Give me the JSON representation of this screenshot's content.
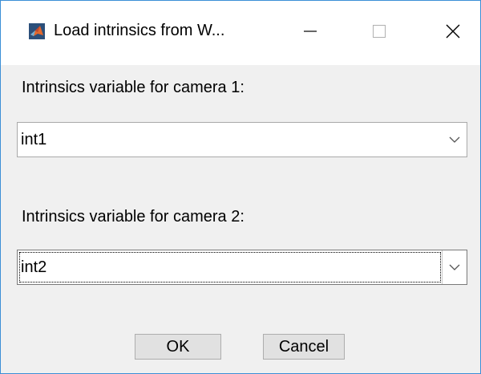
{
  "window": {
    "title": "Load intrinsics from W...",
    "app_icon": "matlab-logo-icon",
    "controls": [
      "minimize-icon",
      "maximize-icon",
      "close-icon"
    ]
  },
  "form": {
    "camera1_label": "Intrinsics variable for camera 1:",
    "camera1_value": "int1",
    "camera2_label": "Intrinsics variable for camera 2:",
    "camera2_value": "int2"
  },
  "buttons": {
    "ok_label": "OK",
    "cancel_label": "Cancel"
  },
  "colors": {
    "window_border": "#3c8fd6",
    "content_background": "#f0f0f0",
    "button_background": "#e1e1e1"
  }
}
